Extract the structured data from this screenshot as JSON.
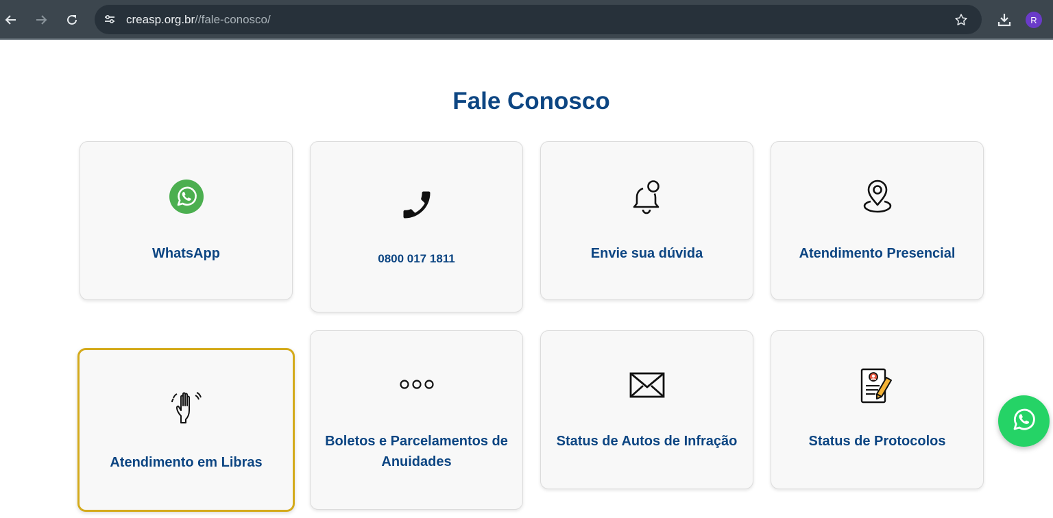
{
  "browser": {
    "url_host": "creasp.org.br",
    "url_path": "//fale-conosco/",
    "profile_initial": "R",
    "icons": [
      "back-icon",
      "forward-icon",
      "reload-icon",
      "site-info-icon",
      "bookmark-star-icon",
      "download-icon"
    ]
  },
  "page": {
    "title": "Fale Conosco"
  },
  "cards": [
    {
      "label": "WhatsApp",
      "icon": "whatsapp-icon"
    },
    {
      "label": "0800 017 1811",
      "icon": "phone-icon"
    },
    {
      "label": "Envie sua dúvida",
      "icon": "bell-icon"
    },
    {
      "label": "Atendimento Presencial",
      "icon": "location-pin-icon"
    },
    {
      "label": "Atendimento em Libras",
      "icon": "waving-hand-icon"
    },
    {
      "label": "Boletos e Parcelamentos de Anuidades",
      "icon": "more-dots-icon"
    },
    {
      "label": "Status de Autos de Infração",
      "icon": "envelope-icon"
    },
    {
      "label": "Status de Protocolos",
      "icon": "protocol-document-icon"
    }
  ],
  "floating_button": {
    "icon": "whatsapp-icon"
  },
  "colors": {
    "brand_blue": "#0c4582",
    "whatsapp_green": "#25d366",
    "focus_outline": "#d4aa1b",
    "chrome_bg": "#3c464e"
  }
}
